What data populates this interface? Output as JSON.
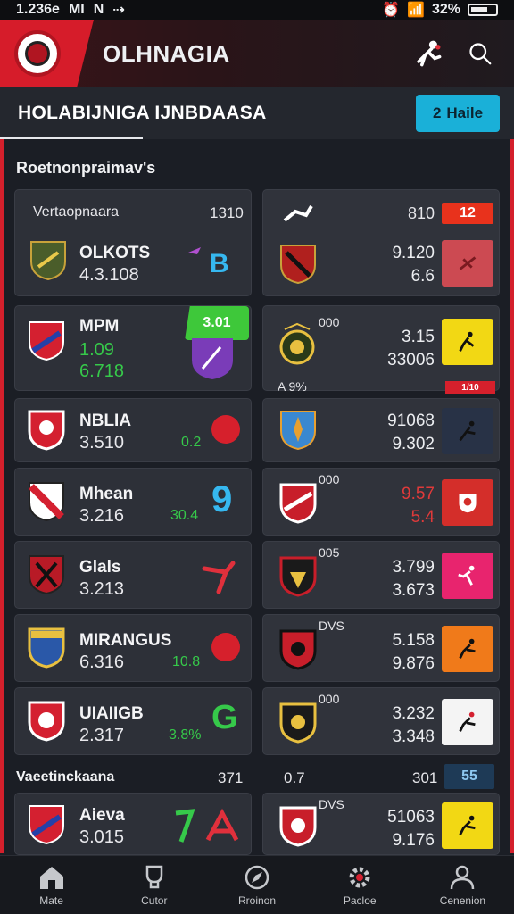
{
  "status": {
    "time": "1.236e",
    "carrier": "MI",
    "extra": "N",
    "battery": "32%"
  },
  "header": {
    "app_name": "OLHNAGIA"
  },
  "subbar": {
    "title": "HOLABIJNIGA IJNBDAASA",
    "button_label": "Haile",
    "button_icon": "2"
  },
  "section1": {
    "title": "Roetnonpraimav's"
  },
  "section2": {
    "title": "Vaeetinckaana",
    "col1": "371",
    "col2": "0.7",
    "col3": "301",
    "badge": "55"
  },
  "left_cards": [
    {
      "header": "Vertaopnaara",
      "header_value": "1310",
      "name": "OLKOTS",
      "score": "4.3.108",
      "extra": ""
    },
    {
      "name": "MPM",
      "score": "1.09",
      "score2": "6.718",
      "badge": "3.01"
    },
    {
      "name": "NBLIA",
      "score": "3.510",
      "extra": "0.2"
    },
    {
      "name": "Mhean",
      "score": "3.216",
      "extra": "30.4",
      "big": "9"
    },
    {
      "name": "Glals",
      "score": "3.213"
    },
    {
      "name": "MIRANGUS",
      "score": "6.316",
      "extra": "10.8"
    },
    {
      "name": "UIAIIGB",
      "score": "2.317",
      "extra": "3.8%"
    },
    {
      "name": "Aieva",
      "score": "3.015"
    }
  ],
  "right_cards": [
    {
      "v1": "810",
      "chip": "12",
      "n1": "9.120",
      "n2": "6.6"
    },
    {
      "label": "000",
      "n1": "3.15",
      "n2": "33006",
      "footer": "A 9%",
      "footer_chip": "1/10"
    },
    {
      "n1": "91068",
      "n2": "9.302"
    },
    {
      "label": "000",
      "n1": "9.57",
      "n2": "5.4"
    },
    {
      "label": "005",
      "n1": "3.799",
      "n2": "3.673"
    },
    {
      "label": "DVS",
      "n1": "5.158",
      "n2": "9.876"
    },
    {
      "label": "000",
      "n1": "3.232",
      "n2": "3.348"
    },
    {
      "label": "DVS",
      "n1": "51063",
      "n2": "9.176"
    }
  ],
  "nav": [
    {
      "label": "Mate",
      "icon": "home-icon"
    },
    {
      "label": "Cutor",
      "icon": "cup-icon"
    },
    {
      "label": "Rroinon",
      "icon": "compass-icon"
    },
    {
      "label": "Pacloe",
      "icon": "gear-icon"
    },
    {
      "label": "Cenenion",
      "icon": "profile-icon"
    }
  ]
}
